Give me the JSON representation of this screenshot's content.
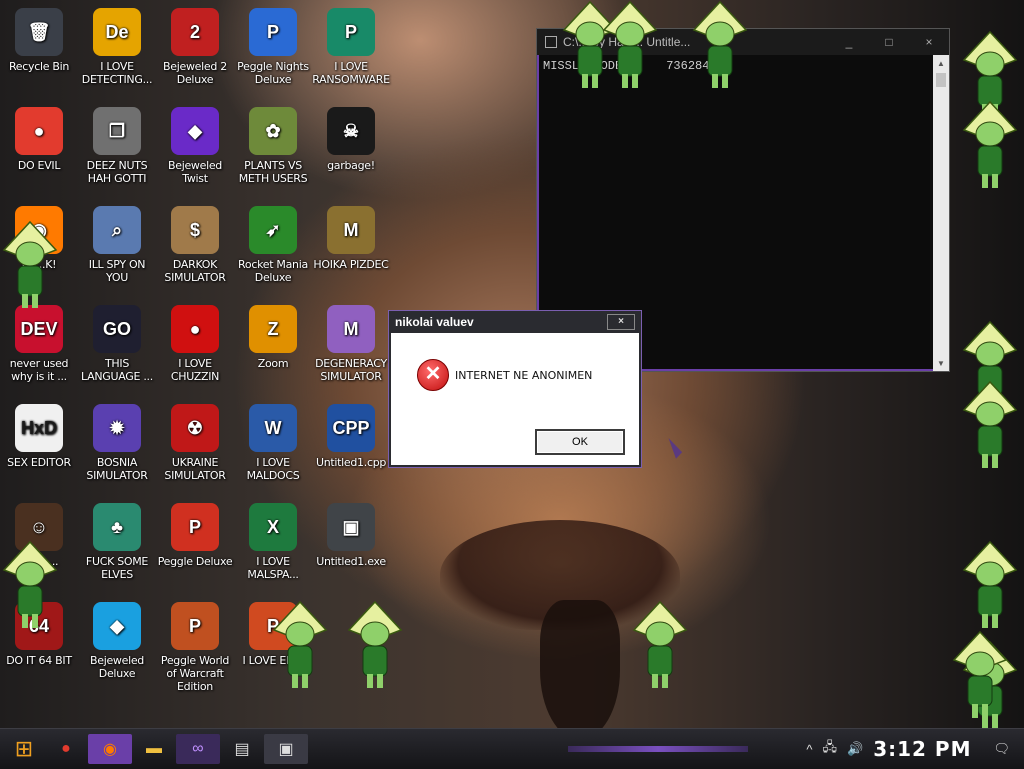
{
  "desktop": {
    "icons": [
      {
        "label": "Recycle Bin",
        "glyph": "🗑",
        "bg": "#3a3f48"
      },
      {
        "label": "I LOVE DETECTING...",
        "glyph": "De",
        "bg": "#e5a400"
      },
      {
        "label": "Bejeweled 2 Deluxe",
        "glyph": "2",
        "bg": "#c02020"
      },
      {
        "label": "Peggle Nights Deluxe",
        "glyph": "P",
        "bg": "#2a6ad4"
      },
      {
        "label": "I LOVE RANSOMWARE",
        "glyph": "P",
        "bg": "#188a68"
      },
      {
        "label": "DO EVIL",
        "glyph": "●",
        "bg": "#e23b2e"
      },
      {
        "label": "DEEZ NUTS HAH GOTTI",
        "glyph": "❐",
        "bg": "#707070"
      },
      {
        "label": "Bejeweled Twist",
        "glyph": "◆",
        "bg": "#6a2ac8"
      },
      {
        "label": "PLANTS VS METH USERS",
        "glyph": "✿",
        "bg": "#6e8a3a"
      },
      {
        "label": "garbage!",
        "glyph": "☠",
        "bg": "#1a1a1a"
      },
      {
        "label": "F......K!",
        "glyph": "◉",
        "bg": "#ff7a00"
      },
      {
        "label": "ILL SPY ON YOU",
        "glyph": "⌕",
        "bg": "#5a7ab0"
      },
      {
        "label": "DARKOK SIMULATOR",
        "glyph": "$",
        "bg": "#a07a4a"
      },
      {
        "label": "Rocket Mania Deluxe",
        "glyph": "➶",
        "bg": "#2a8a2a"
      },
      {
        "label": "HOIKA PIZDEC",
        "glyph": "M",
        "bg": "#8a7030"
      },
      {
        "label": "never used why is it ...",
        "glyph": "DEV",
        "bg": "#c8102e"
      },
      {
        "label": "THIS LANGUAGE ...",
        "glyph": "GO",
        "bg": "#1f1f30"
      },
      {
        "label": "I LOVE CHUZZIN",
        "glyph": "●",
        "bg": "#d01010"
      },
      {
        "label": "Zoom",
        "glyph": "Z",
        "bg": "#e09000"
      },
      {
        "label": "DEGENERACY SIMULATOR",
        "glyph": "M",
        "bg": "#9060c0"
      },
      {
        "label": "SEX EDITOR",
        "glyph": "HxD",
        "bg": "#f0f0f0"
      },
      {
        "label": "BOSNIA SIMULATOR",
        "glyph": "✹",
        "bg": "#5a40b0"
      },
      {
        "label": "UKRAINE SIMULATOR",
        "glyph": "☢",
        "bg": "#c01818"
      },
      {
        "label": "I LOVE MALDOCS",
        "glyph": "W",
        "bg": "#2a5aa8"
      },
      {
        "label": "Untitled1.cpp",
        "glyph": "CPP",
        "bg": "#2050a0"
      },
      {
        "label": "DO.......",
        "glyph": "☺",
        "bg": "#4a3020"
      },
      {
        "label": "FUCK SOME ELVES",
        "glyph": "♣",
        "bg": "#2a8a70"
      },
      {
        "label": "Peggle Deluxe",
        "glyph": "P",
        "bg": "#d03020"
      },
      {
        "label": "I LOVE MALSPA...",
        "glyph": "X",
        "bg": "#1e7a3e"
      },
      {
        "label": "Untitled1.exe",
        "glyph": "▣",
        "bg": "#404448"
      },
      {
        "label": "DO IT 64 BIT",
        "glyph": "64",
        "bg": "#a01818"
      },
      {
        "label": "Bejeweled Deluxe",
        "glyph": "◆",
        "bg": "#1aa0e0"
      },
      {
        "label": "Peggle World of Warcraft Edition",
        "glyph": "P",
        "bg": "#c05020"
      },
      {
        "label": "I LOVE EN...",
        "glyph": "P",
        "bg": "#d04a20"
      }
    ]
  },
  "console": {
    "title": "C:\\...rey Hale... Untitle...",
    "controls": [
      "_",
      "□",
      "×"
    ],
    "line_label": "MISSLE CODE",
    "line_value": "736284",
    "scroll_up": "▲",
    "scroll_down": "▼"
  },
  "dialog": {
    "title": "nikolai valuev",
    "close": "×",
    "error_glyph": "✕",
    "message": "INTERNET NE ANONIMEN",
    "ok_label": "OK"
  },
  "taskbar": {
    "start_glyph": "⊞",
    "apps": [
      {
        "name": "chrome",
        "glyph": "●",
        "color": "#e23b2e",
        "bg": "transparent"
      },
      {
        "name": "firefox",
        "glyph": "◉",
        "color": "#ff7a00",
        "bg": "#6a3fa8"
      },
      {
        "name": "explorer",
        "glyph": "▬",
        "color": "#f0c040",
        "bg": "transparent"
      },
      {
        "name": "visual-studio",
        "glyph": "∞",
        "color": "#c090ff",
        "bg": "#3a2a5a"
      },
      {
        "name": "app",
        "glyph": "▤",
        "color": "#dddddd",
        "bg": "transparent"
      },
      {
        "name": "console",
        "glyph": "▣",
        "color": "#dddddd",
        "bg": "#3a3a44"
      }
    ],
    "tray": {
      "chevron": "^",
      "network": "🖧",
      "volume": "🔊",
      "clock": "3:12 PM",
      "notification": "🗨"
    }
  }
}
